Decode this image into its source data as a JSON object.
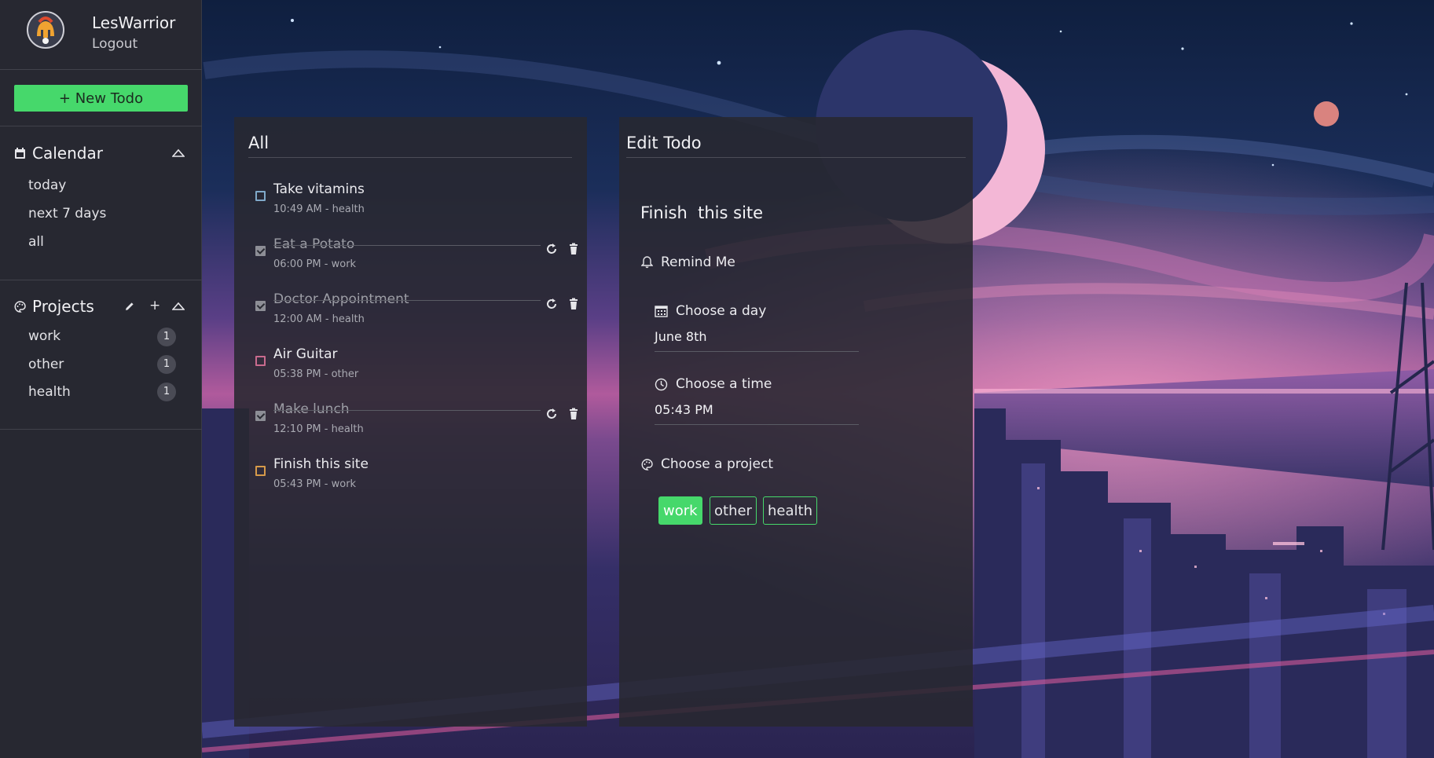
{
  "user": {
    "name": "LesWarrior",
    "logout_label": "Logout"
  },
  "new_todo_label": "+ New Todo",
  "calendar": {
    "title": "Calendar",
    "items": [
      "today",
      "next 7 days",
      "all"
    ]
  },
  "projects": {
    "title": "Projects",
    "add_label": "+",
    "items": [
      {
        "name": "work",
        "count": "1"
      },
      {
        "name": "other",
        "count": "1"
      },
      {
        "name": "health",
        "count": "1"
      }
    ]
  },
  "list_panel": {
    "title": "All",
    "todos": [
      {
        "title": "Take vitamins",
        "meta": "10:49 AM - health",
        "done": false,
        "color": "#7fa9c9"
      },
      {
        "title": "Eat a Potato",
        "meta": "06:00 PM - work",
        "done": true,
        "color": "#8d8e96"
      },
      {
        "title": "Doctor Appointment",
        "meta": "12:00 AM - health",
        "done": true,
        "color": "#8d8e96"
      },
      {
        "title": "Air Guitar",
        "meta": "05:38 PM - other",
        "done": false,
        "color": "#c96b8e"
      },
      {
        "title": "Make lunch",
        "meta": "12:10 PM - health",
        "done": true,
        "color": "#8d8e96"
      },
      {
        "title": "Finish this site",
        "meta": "05:43 PM - work",
        "done": false,
        "color": "#d69a4a"
      }
    ]
  },
  "edit_panel": {
    "title": "Edit Todo",
    "todo_title": "Finish  this site",
    "remind_label": "Remind Me",
    "day_label": "Choose a day",
    "day_value": "June 8th",
    "time_label": "Choose a time",
    "time_value": "05:43 PM",
    "project_label": "Choose a project",
    "project_options": [
      "work",
      "other",
      "health"
    ],
    "selected_project": "work"
  },
  "colors": {
    "accent": "#46d86b",
    "sidebar": "#272831",
    "panel": "#282830"
  }
}
